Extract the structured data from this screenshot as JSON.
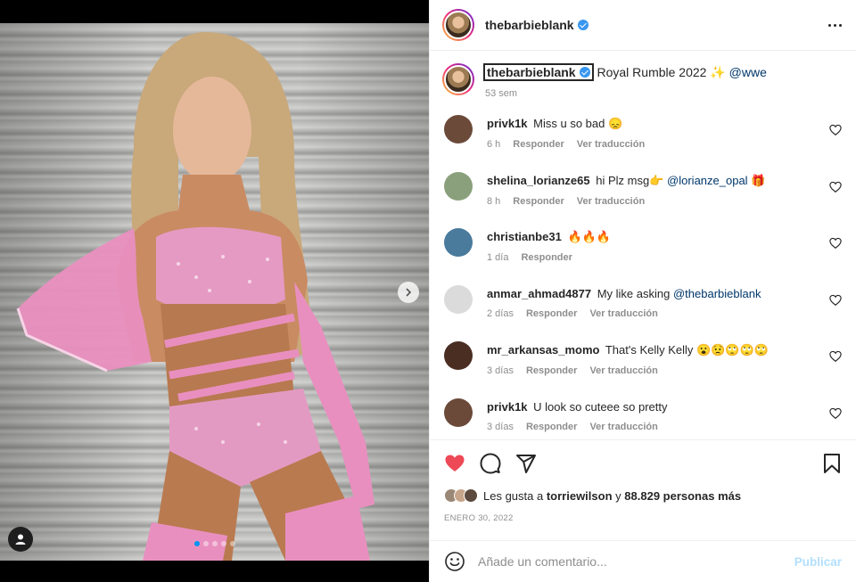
{
  "post": {
    "author": "thebarbieblank",
    "carousel": {
      "slide_count": 5,
      "active_slide": 1
    }
  },
  "caption": {
    "username": "thebarbieblank",
    "text": "Royal Rumble 2022 ✨",
    "mention": "@wwe",
    "age": "53 sem"
  },
  "comments": [
    {
      "user": "privk1k",
      "text": "Miss u so bad",
      "emoji": "😞",
      "age": "6 h",
      "reply": "Responder",
      "translate": "Ver traducción",
      "avatar_color": "#6b4a3a"
    },
    {
      "user": "shelina_lorianze65",
      "text": "hi Plz msg👉",
      "mention": "@lorianze_opal",
      "emoji": "🎁",
      "age": "8 h",
      "reply": "Responder",
      "translate": "Ver traducción",
      "avatar_color": "#8aa07c"
    },
    {
      "user": "christianbe31",
      "text": "",
      "emoji": "🔥🔥🔥",
      "age": "1 día",
      "reply": "Responder",
      "translate": "",
      "avatar_color": "#4a7a9c"
    },
    {
      "user": "anmar_ahmad4877",
      "text": "My like asking",
      "mention": "@thebarbieblank",
      "emoji": "",
      "age": "2 días",
      "reply": "Responder",
      "translate": "Ver traducción",
      "avatar_color": "#dbdbdb"
    },
    {
      "user": "mr_arkansas_momo",
      "text": "That's Kelly Kelly",
      "emoji": "😮😟🙄🙄🙄",
      "age": "3 días",
      "reply": "Responder",
      "translate": "Ver traducción",
      "avatar_color": "#4a2e22"
    },
    {
      "user": "privk1k",
      "text": "U look so cuteee so pretty",
      "emoji": "",
      "age": "3 días",
      "reply": "Responder",
      "translate": "Ver traducción",
      "avatar_color": "#6b4a3a"
    }
  ],
  "likes": {
    "prefix": "Les gusta a",
    "user": "torriewilson",
    "joiner": "y",
    "count_text": "88.829 personas más",
    "liked": true
  },
  "date": "ENERO 30, 2022",
  "add_comment": {
    "placeholder": "Añade un comentario...",
    "publish": "Publicar"
  },
  "colors": {
    "accent": "#0095f6",
    "liked_heart": "#ed4956",
    "pink_outfit": "#e98fbf"
  },
  "icons": {
    "header": [
      "verified-icon",
      "more-options-icon"
    ],
    "actions": [
      "heart-icon",
      "comment-icon",
      "share-icon",
      "bookmark-icon"
    ],
    "media": [
      "next-arrow-icon",
      "user-tag-icon"
    ],
    "composer": [
      "emoji-icon"
    ]
  }
}
